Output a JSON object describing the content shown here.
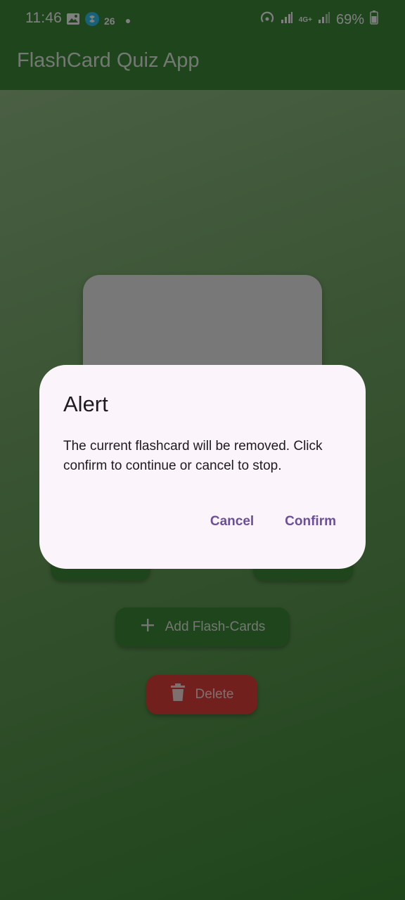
{
  "status_bar": {
    "time": "11:46",
    "notification_number": "26",
    "battery": "69%",
    "network": "4G+"
  },
  "app_bar": {
    "title": "FlashCard Quiz App"
  },
  "main": {
    "add_button_label": "Add Flash-Cards",
    "delete_button_label": "Delete"
  },
  "dialog": {
    "title": "Alert",
    "message": "The current flashcard will be removed. Click confirm to continue or cancel to stop.",
    "cancel_label": "Cancel",
    "confirm_label": "Confirm"
  },
  "colors": {
    "primary": "#3f8a3a",
    "delete": "#e4413b",
    "dialog_surface": "#fcf4fb",
    "dialog_action": "#6b4f9b"
  }
}
